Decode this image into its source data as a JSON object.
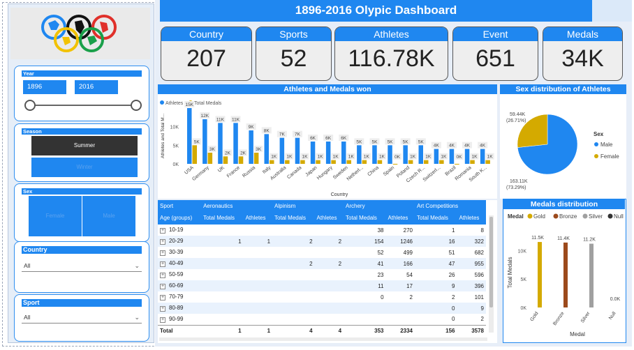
{
  "dashboard": {
    "title": "1896-2016 Olypic Dashboard"
  },
  "kpis": [
    {
      "label": "Country",
      "value": "207"
    },
    {
      "label": "Sports",
      "value": "52"
    },
    {
      "label": "Athletes",
      "value": "116.78K"
    },
    {
      "label": "Event",
      "value": "651"
    },
    {
      "label": "Medals",
      "value": "34K"
    }
  ],
  "filters": {
    "year": {
      "label": "Year",
      "from": "1896",
      "to": "2016",
      "range": [
        1896,
        2016
      ]
    },
    "season": {
      "label": "Season",
      "options": [
        "Summer",
        "Winter"
      ],
      "selected": "Summer"
    },
    "sex": {
      "label": "Sex",
      "options": [
        "Female",
        "Male"
      ]
    },
    "country": {
      "label": "Country",
      "value": "All"
    },
    "sport": {
      "label": "Sport",
      "value": "All"
    }
  },
  "colors": {
    "accent": "#1f87f0",
    "gold": "#d4aa00",
    "bronze": "#9c4a1c",
    "silver": "#a0a0a0",
    "dark": "#333333"
  },
  "charts": [
    {
      "type": "bar",
      "title": "Athletes and Medals won",
      "xlabel": "Country",
      "ylabel": "Athletes and Total M...",
      "ylim": [
        0,
        15000
      ],
      "yticks": [
        "0K",
        "5K",
        "10K"
      ],
      "legend_position": "top-left",
      "categories": [
        "USA",
        "Germany",
        "UK",
        "France",
        "Russia",
        "Italy",
        "Australia",
        "Canada",
        "Japan",
        "Hungary",
        "Sweden",
        "Netherl...",
        "China",
        "Spain",
        "Poland",
        "Czech R...",
        "Switzerl...",
        "Brazil",
        "Romania",
        "South K..."
      ],
      "series": [
        {
          "name": "Athletes",
          "color": "#1f87f0",
          "values": [
            15000,
            12000,
            11000,
            11000,
            9000,
            8000,
            7000,
            7000,
            6000,
            6000,
            6000,
            5000,
            5000,
            5000,
            5000,
            5000,
            4000,
            4000,
            4000,
            4000
          ],
          "labels": [
            "15K",
            "12K",
            "11K",
            "11K",
            "9K",
            "8K",
            "7K",
            "7K",
            "6K",
            "6K",
            "6K",
            "5K",
            "5K",
            "5K",
            "5K",
            "5K",
            "4K",
            "4K",
            "4K",
            "4K"
          ]
        },
        {
          "name": "Total Medals",
          "color": "#d4aa00",
          "values": [
            5000,
            3000,
            2000,
            2000,
            3000,
            1000,
            1000,
            1000,
            1000,
            1000,
            1000,
            1000,
            1000,
            0,
            1000,
            1000,
            1000,
            0,
            1000,
            1000
          ],
          "labels": [
            "5K",
            "3K",
            "2K",
            "2K",
            "3K",
            "1K",
            "1K",
            "1K",
            "1K",
            "1K",
            "1K",
            "1K",
            "1K",
            "0K",
            "1K",
            "1K",
            "1K",
            "0K",
            "1K",
            "1K"
          ]
        }
      ]
    },
    {
      "type": "pie",
      "title": "Sex distribution of Athletes",
      "legend_title": "Sex",
      "legend_position": "right",
      "slices": [
        {
          "name": "Male",
          "value": 163110,
          "label": "163.11K",
          "pct": "(73.29%)",
          "color": "#1f87f0"
        },
        {
          "name": "Female",
          "value": 59440,
          "label": "59.44K",
          "pct": "(26.71%)",
          "color": "#d4aa00"
        }
      ]
    },
    {
      "type": "bar",
      "title": "Medals distribution",
      "xlabel": "Medal",
      "ylabel": "Total Medals",
      "legend_title": "Medal",
      "legend_position": "top",
      "ylim": [
        0,
        12000
      ],
      "yticks": [
        "0K",
        "5K",
        "10K"
      ],
      "categories": [
        "Gold",
        "Bronze",
        "Silver",
        "Null"
      ],
      "values": [
        11500,
        11400,
        11200,
        0
      ],
      "labels": [
        "11.5K",
        "11.4K",
        "11.2K",
        "0.0K"
      ],
      "colors": [
        "#d4aa00",
        "#9c4a1c",
        "#a0a0a0",
        "#333333"
      ]
    }
  ],
  "matrix": {
    "row_header": "Sport",
    "row_sub_header": "Age (groups)",
    "columns": [
      "Aeronautics",
      "Alpinism",
      "Archery",
      "Art Competitions"
    ],
    "sub_columns": [
      "Total Medals",
      "Athletes"
    ],
    "rows": [
      {
        "age": "10-19",
        "cells": [
          "",
          "",
          "",
          "",
          "38",
          "270",
          "1",
          "8"
        ]
      },
      {
        "age": "20-29",
        "cells": [
          "1",
          "1",
          "2",
          "2",
          "154",
          "1246",
          "16",
          "322"
        ]
      },
      {
        "age": "30-39",
        "cells": [
          "",
          "",
          "",
          "",
          "52",
          "499",
          "51",
          "682"
        ]
      },
      {
        "age": "40-49",
        "cells": [
          "",
          "",
          "2",
          "2",
          "41",
          "166",
          "47",
          "955"
        ]
      },
      {
        "age": "50-59",
        "cells": [
          "",
          "",
          "",
          "",
          "23",
          "54",
          "26",
          "596"
        ]
      },
      {
        "age": "60-69",
        "cells": [
          "",
          "",
          "",
          "",
          "11",
          "17",
          "9",
          "396"
        ]
      },
      {
        "age": "70-79",
        "cells": [
          "",
          "",
          "",
          "",
          "0",
          "2",
          "2",
          "101"
        ]
      },
      {
        "age": "80-89",
        "cells": [
          "",
          "",
          "",
          "",
          "",
          "",
          "0",
          "9"
        ]
      },
      {
        "age": "90-99",
        "cells": [
          "",
          "",
          "",
          "",
          "",
          "",
          "0",
          "2"
        ]
      }
    ],
    "total_label": "Total",
    "totals": [
      "1",
      "1",
      "4",
      "4",
      "353",
      "2334",
      "156",
      "3578"
    ]
  }
}
